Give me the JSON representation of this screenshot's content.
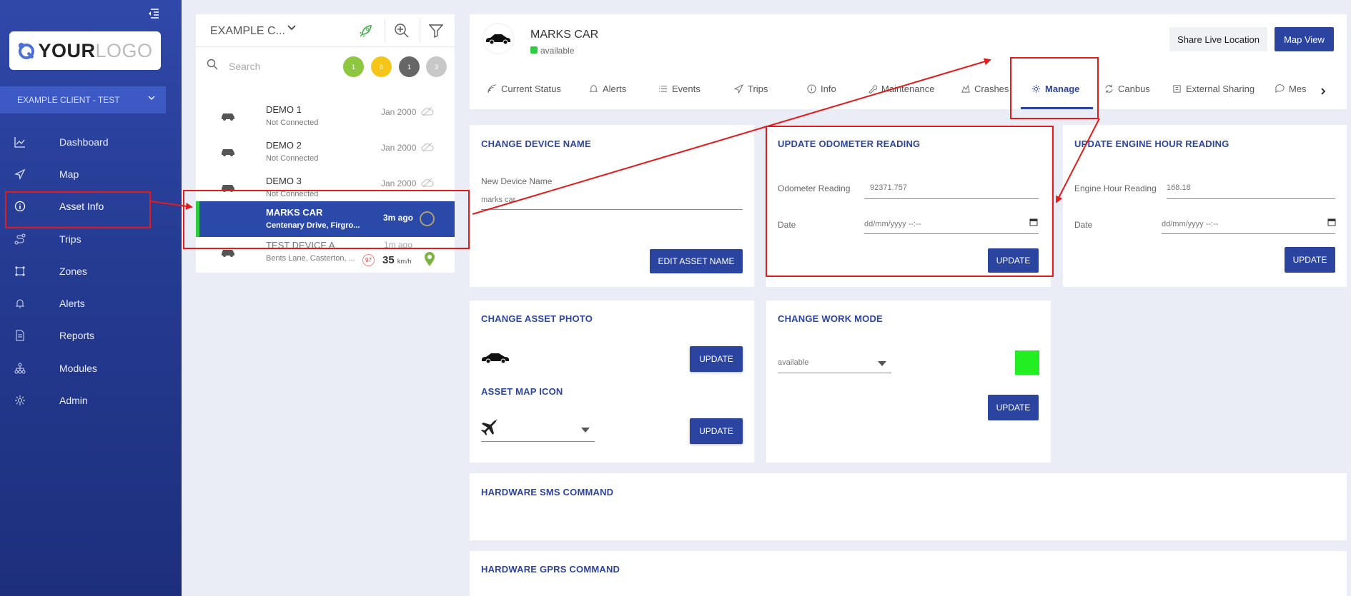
{
  "logo": {
    "your": "YOUR",
    "logo": "LOGO"
  },
  "client": {
    "label": "EXAMPLE CLIENT - TEST"
  },
  "nav": [
    {
      "label": "Dashboard",
      "icon": "chart-line-icon"
    },
    {
      "label": "Map",
      "icon": "navigation-arrow-icon"
    },
    {
      "label": "Asset Info",
      "icon": "info-circle-icon"
    },
    {
      "label": "Trips",
      "icon": "route-icon"
    },
    {
      "label": "Zones",
      "icon": "polygon-icon"
    },
    {
      "label": "Alerts",
      "icon": "bell-icon"
    },
    {
      "label": "Reports",
      "icon": "document-icon"
    },
    {
      "label": "Modules",
      "icon": "modules-icon"
    },
    {
      "label": "Admin",
      "icon": "gear-icon"
    }
  ],
  "list": {
    "title": "EXAMPLE C...",
    "search_placeholder": "Search",
    "status_counts": [
      {
        "count": "1",
        "color": "#8dc63f"
      },
      {
        "count": "0",
        "color": "#f5c518"
      },
      {
        "count": "1",
        "color": "#666666"
      },
      {
        "count": "3",
        "color": "#c8c8c8"
      }
    ],
    "devices": [
      {
        "name": "DEMO 1",
        "status": "Not Connected",
        "date": "Jan 2000"
      },
      {
        "name": "DEMO 2",
        "status": "Not Connected",
        "date": "Jan 2000"
      },
      {
        "name": "DEMO 3",
        "status": "Not Connected",
        "date": "Jan 2000"
      },
      {
        "name": "MARKS CAR",
        "status": "Centenary Drive, Firgro...",
        "date": "3m ago"
      },
      {
        "name": "TEST DEVICE A",
        "status": "Bents Lane, Casterton, ...",
        "date": "1m ago",
        "badge": "97",
        "speed": "35",
        "speed_unit": "km/h"
      }
    ]
  },
  "asset": {
    "name": "MARKS CAR",
    "status": "available",
    "status_color": "#2ecc40",
    "share_button": "Share Live Location",
    "map_button": "Map View"
  },
  "tabs": [
    "Current Status",
    "Alerts",
    "Events",
    "Trips",
    "Info",
    "Maintenance",
    "Crashes",
    "Manage",
    "Canbus",
    "External Sharing",
    "Mes"
  ],
  "cards": {
    "device_name": {
      "title": "CHANGE DEVICE NAME",
      "label": "New Device Name",
      "value": "marks car",
      "button": "EDIT ASSET NAME"
    },
    "odometer": {
      "title": "UPDATE ODOMETER READING",
      "reading_label": "Odometer Reading",
      "reading_value": "92371.757",
      "date_label": "Date",
      "date_placeholder": "dd/mm/yyyy --:--",
      "button": "UPDATE"
    },
    "engine_hours": {
      "title": "UPDATE ENGINE HOUR READING",
      "reading_label": "Engine Hour Reading",
      "reading_value": "168.18",
      "date_label": "Date",
      "date_placeholder": "dd/mm/yyyy --:--",
      "button": "UPDATE"
    },
    "asset_photo": {
      "title": "CHANGE ASSET PHOTO",
      "button": "UPDATE",
      "map_icon_title": "ASSET MAP ICON",
      "map_icon_button": "UPDATE"
    },
    "work_mode": {
      "title": "CHANGE WORK MODE",
      "value": "available",
      "color": "#22ee22",
      "button": "UPDATE"
    },
    "sms": {
      "title": "HARDWARE SMS COMMAND"
    },
    "gprs": {
      "title": "HARDWARE GPRS COMMAND"
    }
  },
  "annotation_color": "#e31b1b"
}
